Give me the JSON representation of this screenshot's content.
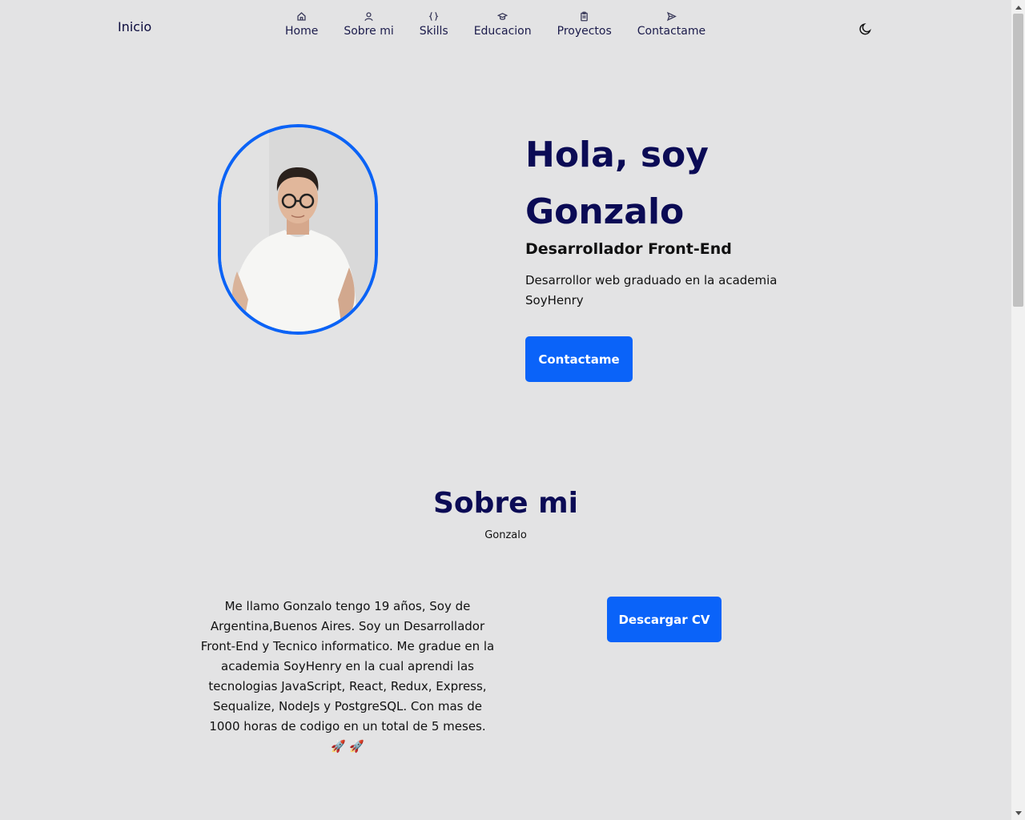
{
  "header": {
    "brand": "Inicio",
    "nav": [
      {
        "label": "Home",
        "icon": "home-icon"
      },
      {
        "label": "Sobre mi",
        "icon": "user-icon"
      },
      {
        "label": "Skills",
        "icon": "code-braces-icon"
      },
      {
        "label": "Educacion",
        "icon": "graduation-cap-icon"
      },
      {
        "label": "Proyectos",
        "icon": "clipboard-icon"
      },
      {
        "label": "Contactame",
        "icon": "send-icon"
      }
    ],
    "theme_toggle_icon": "moon-icon"
  },
  "hero": {
    "title": "Hola, soy Gonzalo",
    "subtitle": "Desarrollador Front-End",
    "description": "Desarrollor web graduado en la academia SoyHenry",
    "button_label": "Contactame"
  },
  "about": {
    "title": "Sobre mi",
    "subtitle": "Gonzalo",
    "text": "Me llamo Gonzalo tengo 19 años, Soy de Argentina,Buenos Aires. Soy un Desarrollador Front-End y Tecnico informatico. Me gradue en la academia SoyHenry en la cual aprendi las tecnologias JavaScript, React, Redux, Express, Sequalize, NodeJs y PostgreSQL. Con mas de 1000 horas de codigo en un total de 5 meses. 🚀 🚀",
    "button_label": "Descargar CV"
  },
  "colors": {
    "background": "#e3e3e4",
    "primary": "#0a63f9",
    "heading": "#0b0b55"
  }
}
